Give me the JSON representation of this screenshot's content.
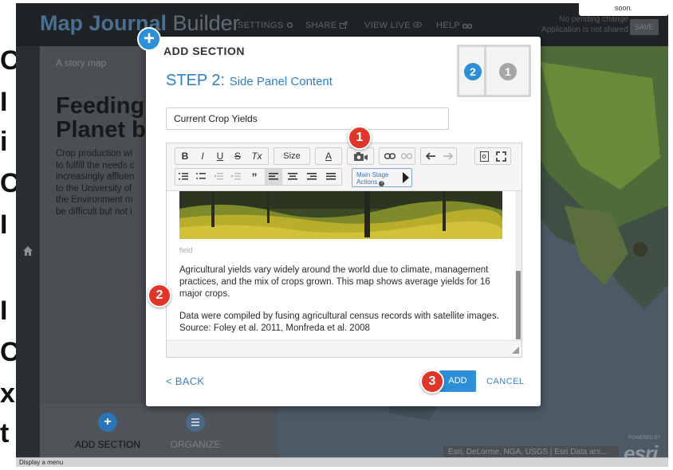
{
  "app": {
    "logo_strong": "Map Journal",
    "logo_light": "Builder",
    "nav": {
      "settings": "SETTINGS",
      "share": "SHARE",
      "view_live": "VIEW LIVE",
      "help": "HELP"
    },
    "notice_line1": "No pending change",
    "notice_line2": "Application is not shared",
    "save_label": "SAVE",
    "popup_tip": "soon."
  },
  "side_panel": {
    "subtitle": "A story map",
    "title": "Feeding the\nPlanet b",
    "body": "Crop production wi\nto fulfill the needs c\nincreasingly affluen\nto the University of\nthe Environment m\nbe difficult but not i",
    "footer": {
      "add_section": "ADD SECTION",
      "organize": "ORGANIZE",
      "add_icon": "+",
      "organize_icon": "list-icon"
    }
  },
  "background_overflow_text": [
    "C",
    "I",
    "i",
    "C",
    "I",
    "I",
    "C",
    "x",
    "t"
  ],
  "map": {
    "attribution": "Esri, DeLorme, NGA, USGS | Esri Data ars...",
    "powered_by": "POWERED BY",
    "esri_logo": "esri"
  },
  "status_bar": {
    "text": "Display a menu"
  },
  "modal": {
    "title": "ADD SECTION",
    "step_prefix": "STEP 2:",
    "step_name": "Side Panel Content",
    "steps": [
      {
        "number": "2",
        "state": "active"
      },
      {
        "number": "1",
        "state": "inactive"
      }
    ],
    "title_field_value": "Current Crop Yields",
    "toolbar": {
      "bold": "B",
      "italic": "I",
      "underline": "U",
      "strike": "S",
      "clear_format": "Tx",
      "size": "Size",
      "font_color": "A",
      "media_icon": "camera-icon",
      "main_stage_actions_line1": "Main Stage",
      "main_stage_actions_line2": "Actions"
    },
    "image_caption": "field",
    "paragraph1": "Agricultural yields vary widely around the world due to climate, management practices, and the mix of crops grown. This map shows average yields for 16 major crops.",
    "paragraph2": "Data were compiled by fusing agricultural census records with satellite images. Source: Foley et al. 2011, Monfreda et al. 2008",
    "back_label": "< BACK",
    "add_label": "ADD",
    "cancel_label": "CANCEL",
    "plus_badge": "+"
  },
  "callouts": {
    "one": "1",
    "two": "2",
    "three": "3"
  },
  "colors": {
    "accent": "#2d8fd8",
    "callout": "#e0362a",
    "dark_bg": "#2f3538"
  }
}
